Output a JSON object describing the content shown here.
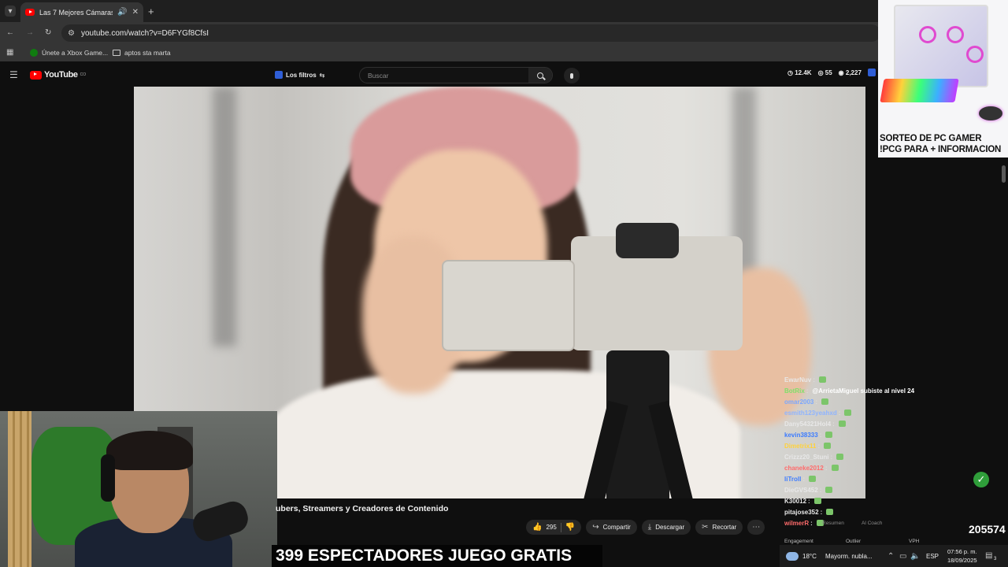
{
  "browser": {
    "tab_title": "Las 7 Mejores Cámaras p",
    "url": "youtube.com/watch?v=D6FYGf8CfsI",
    "bookmarks": [
      "Únete a Xbox Game...",
      "aptos sta marta"
    ]
  },
  "youtube": {
    "logo": "YouTube",
    "logo_country": "CO",
    "filters_label": "Los filtros",
    "search_placeholder": "Buscar",
    "stats": [
      "12.4K",
      "55",
      "2,227"
    ]
  },
  "video": {
    "title_partial": "ubers, Streamers y Creadores de Contenido",
    "actions": {
      "likes": "295",
      "share": "Compartir",
      "download": "Descargar",
      "clip": "Recortar"
    }
  },
  "chat": {
    "messages": [
      {
        "user": "EwarNuv",
        "text": "",
        "color": "#e8e8e8"
      },
      {
        "user": "BotRix",
        "text": "@ArrietaMiguel subiste al nivel 24",
        "color": "#7ee06a"
      },
      {
        "user": "omar2003",
        "text": "",
        "color": "#7aa7ff"
      },
      {
        "user": "esmith123yeahxd",
        "text": "",
        "color": "#8fb4ff"
      },
      {
        "user": "Dany54321Hol4",
        "text": "",
        "color": "#e8e8e8"
      },
      {
        "user": "kevin38333",
        "text": "",
        "color": "#3d7cff"
      },
      {
        "user": "Dimetrix11",
        "text": "",
        "color": "#ffd23b"
      },
      {
        "user": "Crizzz20_Stuni",
        "text": "",
        "color": "#e8e8e8"
      },
      {
        "user": "chaneke2012",
        "text": "",
        "color": "#ff6b6b"
      },
      {
        "user": "liTroll",
        "text": "",
        "color": "#3d7cff"
      },
      {
        "user": "DieGVS452",
        "text": "",
        "color": "#e8e8e8"
      },
      {
        "user": "K30012",
        "text": "",
        "color": "#e8e8e8"
      },
      {
        "user": "pitajose352",
        "text": "",
        "color": "#e8e8e8"
      },
      {
        "user": "wilmerR",
        "text": "",
        "color": "#ff6b6b"
      }
    ],
    "controls": [
      "Resumen",
      "Al Coach"
    ],
    "tabs": [
      "Engagement",
      "Outlier",
      "VPH"
    ]
  },
  "promo": {
    "line1": "SORTEO DE PC GAMER",
    "line2": "!PCG PARA + INFORMACION"
  },
  "overlay": {
    "caption": "399 ESPECTADORES JUEGO GRATIS",
    "counter": "205574"
  },
  "taskbar": {
    "temperature": "18°C",
    "weather": "Mayorm. nubla...",
    "language": "ESP",
    "time": "07:56 p. m.",
    "date": "18/09/2025",
    "notifications": "3"
  }
}
